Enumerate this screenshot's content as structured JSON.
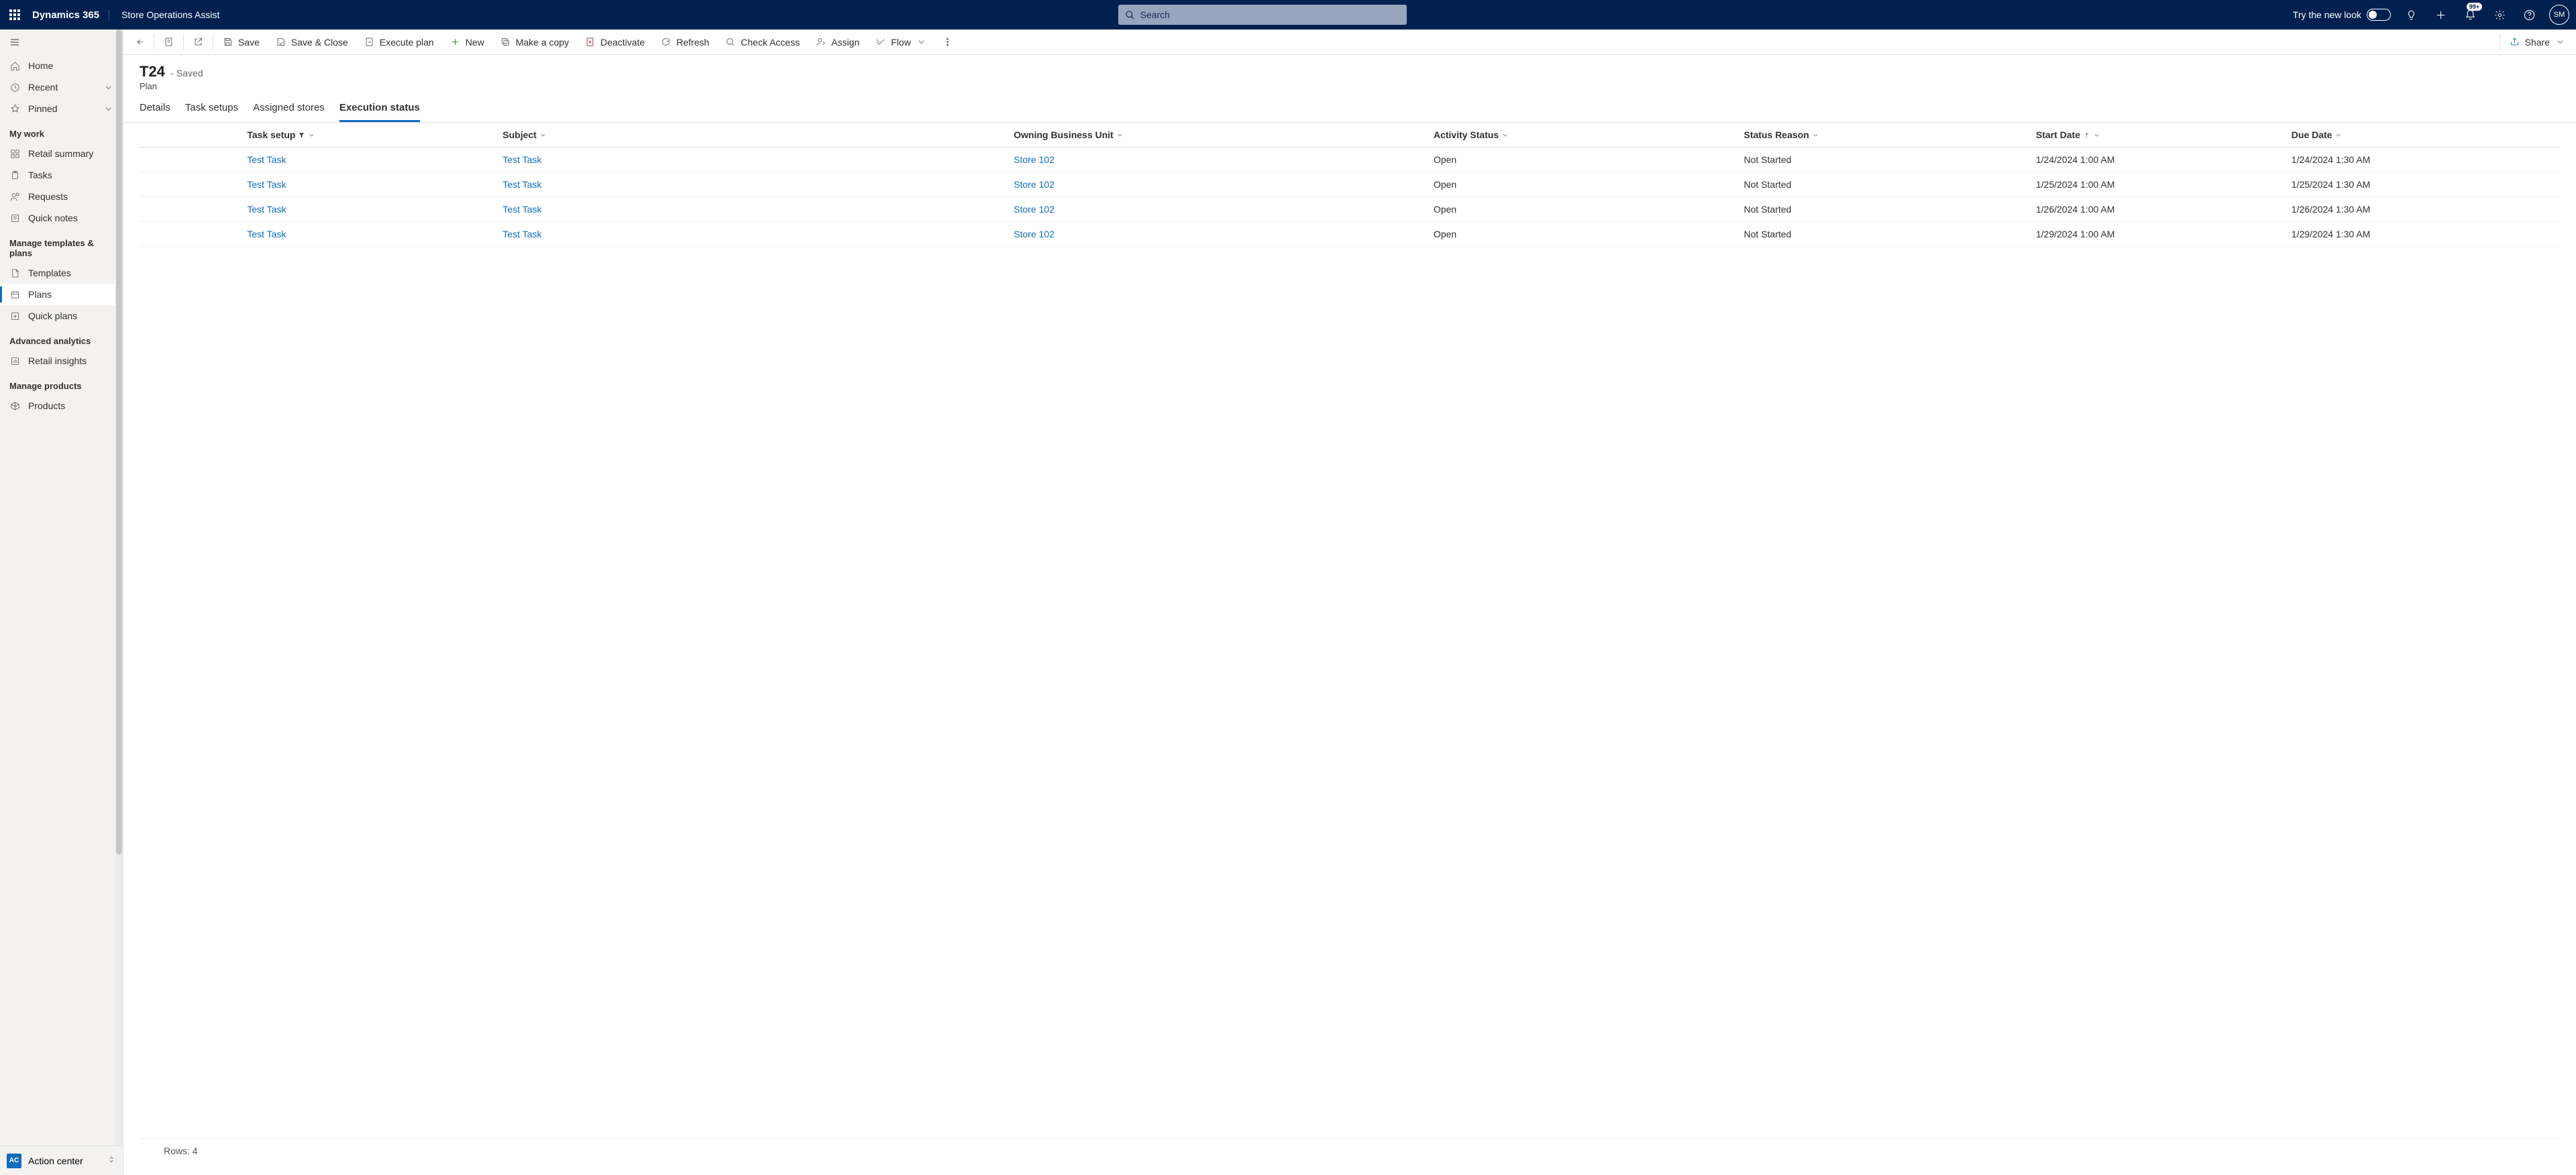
{
  "header": {
    "brand": "Dynamics 365",
    "app": "Store Operations Assist",
    "search_placeholder": "Search",
    "new_look_label": "Try the new look",
    "notification_badge": "99+",
    "avatar_initials": "SM"
  },
  "sidebar": {
    "home": "Home",
    "recent": "Recent",
    "pinned": "Pinned",
    "sections": {
      "my_work": "My work",
      "manage_templates": "Manage templates & plans",
      "advanced_analytics": "Advanced analytics",
      "manage_products": "Manage products"
    },
    "items": {
      "retail_summary": "Retail summary",
      "tasks": "Tasks",
      "requests": "Requests",
      "quick_notes": "Quick notes",
      "templates": "Templates",
      "plans": "Plans",
      "quick_plans": "Quick plans",
      "retail_insights": "Retail insights",
      "products": "Products"
    },
    "action_center": {
      "badge": "AC",
      "label": "Action center"
    }
  },
  "commands": {
    "save": "Save",
    "save_close": "Save & Close",
    "execute_plan": "Execute plan",
    "new": "New",
    "make_copy": "Make a copy",
    "deactivate": "Deactivate",
    "refresh": "Refresh",
    "check_access": "Check Access",
    "assign": "Assign",
    "flow": "Flow",
    "share": "Share"
  },
  "record": {
    "title": "T24",
    "state": "- Saved",
    "type": "Plan"
  },
  "tabs": {
    "details": "Details",
    "task_setups": "Task setups",
    "assigned_stores": "Assigned stores",
    "execution_status": "Execution status"
  },
  "grid": {
    "columns": {
      "task_setup": "Task setup",
      "subject": "Subject",
      "owning_bu": "Owning Business Unit",
      "activity_status": "Activity Status",
      "status_reason": "Status Reason",
      "start_date": "Start Date",
      "due_date": "Due Date"
    },
    "rows": [
      {
        "task_setup": "Test Task",
        "subject": "Test Task",
        "owning_bu": "Store 102",
        "activity_status": "Open",
        "status_reason": "Not Started",
        "start_date": "1/24/2024 1:00 AM",
        "due_date": "1/24/2024 1:30 AM"
      },
      {
        "task_setup": "Test Task",
        "subject": "Test Task",
        "owning_bu": "Store 102",
        "activity_status": "Open",
        "status_reason": "Not Started",
        "start_date": "1/25/2024 1:00 AM",
        "due_date": "1/25/2024 1:30 AM"
      },
      {
        "task_setup": "Test Task",
        "subject": "Test Task",
        "owning_bu": "Store 102",
        "activity_status": "Open",
        "status_reason": "Not Started",
        "start_date": "1/26/2024 1:00 AM",
        "due_date": "1/26/2024 1:30 AM"
      },
      {
        "task_setup": "Test Task",
        "subject": "Test Task",
        "owning_bu": "Store 102",
        "activity_status": "Open",
        "status_reason": "Not Started",
        "start_date": "1/29/2024 1:00 AM",
        "due_date": "1/29/2024 1:30 AM"
      }
    ],
    "footer": "Rows: 4"
  }
}
